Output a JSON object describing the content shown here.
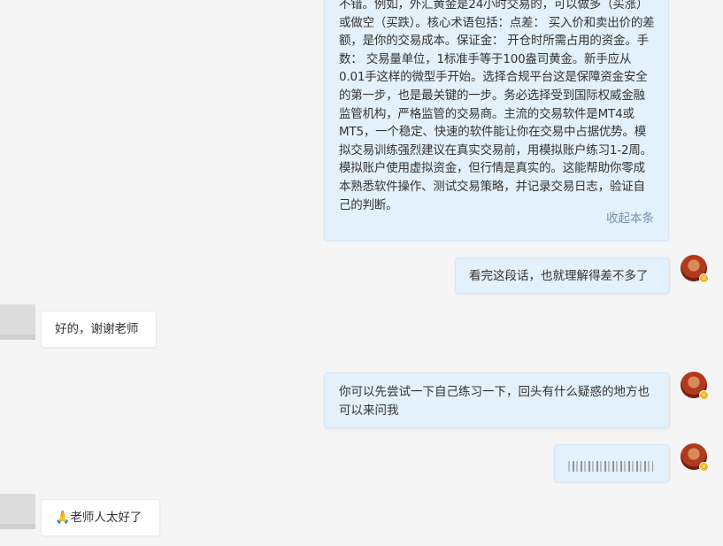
{
  "messages": {
    "long_text": "不错。例如，外汇黄金是24小时交易的，可以做多（买涨）或做空（买跌）。核心术语包括：点差： 买入价和卖出价的差额，是你的交易成本。保证金： 开仓时所需占用的资金。手数： 交易量单位，1标准手等于100盎司黄金。新手应从0.01手这样的微型手开始。选择合规平台这是保障资金安全的第一步，也是最关键的一步。务必选择受到国际权威金融监管机构，严格监管的交易商。主流的交易软件是MT4或MT5，一个稳定、快速的软件能让你在交易中占据优势。模拟交易训练强烈建议在真实交易前，用模拟账户练习1-2周。模拟账户使用虚拟资金，但行情是真实的。这能帮助你零成本熟悉软件操作、测试交易策略，并记录交易日志，验证自己的判断。",
    "collapse_label": "收起本条",
    "out_1": "看完这段话，也就理解得差不多了",
    "in_1": "好的，谢谢老师",
    "out_2": "你可以先尝试一下自己练习一下，回头有什么疑惑的地方也可以来问我",
    "in_2_emoji": "🙏",
    "in_2": "老师人太好了"
  },
  "icons": {
    "avatar": "user-avatar",
    "badge": "verified-badge-icon",
    "praying_hands": "praying-hands-icon",
    "blurred_content": "blurred-text"
  },
  "colors": {
    "background": "#f5f5f5",
    "outgoing_bubble": "#e3f1fc",
    "incoming_bubble": "#ffffff",
    "link": "#7591ad",
    "badge": "#f5b21b"
  }
}
